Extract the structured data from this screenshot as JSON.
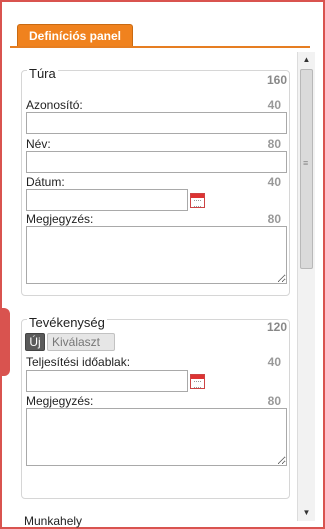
{
  "panel": {
    "tab_label": "Definíciós panel"
  },
  "tura": {
    "title": "Túra",
    "count": "160",
    "fields": [
      {
        "label": "Azonosító:",
        "count": "40",
        "value": ""
      },
      {
        "label": "Név:",
        "count": "80",
        "value": ""
      },
      {
        "label": "Dátum:",
        "count": "40",
        "value": ""
      },
      {
        "label": "Megjegyzés:",
        "count": "80",
        "value": ""
      }
    ]
  },
  "tevekenyseg": {
    "title": "Tevékenység",
    "count": "120",
    "buttons": {
      "new": "Új",
      "select": "Kiválaszt"
    },
    "fields": [
      {
        "label": "Teljesítési időablak:",
        "count": "40",
        "value": ""
      },
      {
        "label": "Megjegyzés:",
        "count": "80",
        "value": ""
      }
    ]
  },
  "next_section_partial": "Munkahely",
  "icons": {
    "calendar": "calendar-icon",
    "scroll_up": "scroll-up-icon",
    "scroll_down": "scroll-down-icon"
  },
  "colors": {
    "accent": "#f0821e",
    "frame": "#d9534f"
  }
}
